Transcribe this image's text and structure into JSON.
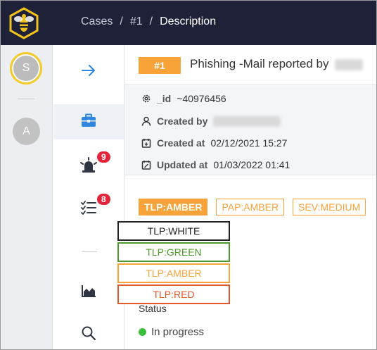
{
  "breadcrumb": {
    "items": [
      "Cases",
      "#1",
      "Description"
    ],
    "separator": "/"
  },
  "user_sidebar": {
    "current_user_initial": "S",
    "other_user_initial": "A"
  },
  "nav": {
    "items": [
      {
        "name": "collapse",
        "icon": "arrow-right-icon"
      },
      {
        "name": "cases",
        "icon": "briefcase-icon"
      },
      {
        "name": "alerts",
        "icon": "siren-icon",
        "badge": "9"
      },
      {
        "name": "tasks",
        "icon": "checklist-icon",
        "badge": "8"
      },
      {
        "name": "dashboards",
        "icon": "area-chart-icon"
      },
      {
        "name": "search",
        "icon": "search-icon"
      }
    ]
  },
  "case": {
    "number": "#1",
    "title": "Phishing -Mail reported by",
    "id_label": "_id",
    "id_value": "~40976456",
    "created_by_label": "Created by",
    "created_at_label": "Created at",
    "created_at_value": "02/12/2021 15:27",
    "updated_at_label": "Updated at",
    "updated_at_value": "01/03/2022 01:41"
  },
  "tags": {
    "tlp": "TLP:AMBER",
    "pap": "PAP:AMBER",
    "severity": "SEV:MEDIUM"
  },
  "tlp_dropdown": {
    "options": [
      {
        "label": "TLP:WHITE",
        "color": "#222222"
      },
      {
        "label": "TLP:GREEN",
        "color": "#4e9a2a"
      },
      {
        "label": "TLP:AMBER",
        "color": "#f7a33a"
      },
      {
        "label": "TLP:RED",
        "color": "#e2582d"
      }
    ]
  },
  "status": {
    "label": "Status",
    "value": "In progress",
    "color": "#3cc03c"
  },
  "colors": {
    "topbar": "#1e2138",
    "accent": "#f7a33a",
    "badge": "#e3243b",
    "nav_active": "#2e86de"
  }
}
